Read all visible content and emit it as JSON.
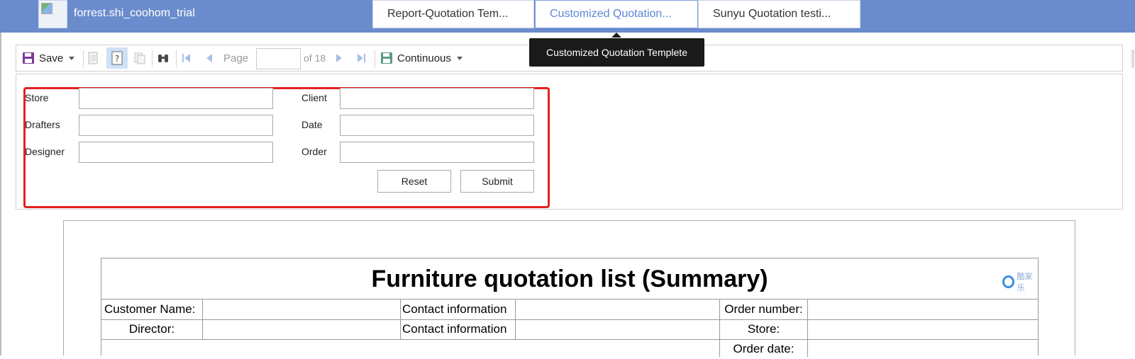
{
  "header": {
    "username": "forrest.shi_coohom_trial",
    "tabs": [
      {
        "label": "Report-Quotation Tem..."
      },
      {
        "label": "Customized Quotation..."
      },
      {
        "label": "Sunyu Quotation testi..."
      }
    ],
    "tooltip": "Customized Quotation Templete"
  },
  "toolbar": {
    "save_label": "Save",
    "page_label": "Page",
    "page_value": "",
    "of_total": "of 18",
    "view_mode": "Continuous"
  },
  "params": {
    "store_label": "Store",
    "drafters_label": "Drafters",
    "designer_label": "Designer",
    "client_label": "Client",
    "date_label": "Date",
    "order_label": "Order",
    "store_value": "",
    "drafters_value": "",
    "designer_value": "",
    "client_value": "",
    "date_value": "",
    "order_value": "",
    "reset_label": "Reset",
    "submit_label": "Submit"
  },
  "report": {
    "title": "Furniture quotation list  (Summary)",
    "logo_text": "酷家乐",
    "rows": [
      {
        "c1": "Customer Name:",
        "c2": "",
        "c3": "Contact information",
        "c4": "",
        "c5": "Order number:",
        "c6": ""
      },
      {
        "c1": "Director:",
        "c2": "",
        "c3": "Contact information",
        "c4": "",
        "c5": "Store:",
        "c6": ""
      },
      {
        "c1": "",
        "c2": "",
        "c3": "",
        "c4": "",
        "c5": "Order date:",
        "c6": ""
      }
    ]
  },
  "colors": {
    "header_bg": "#6b8ccc",
    "active_tab": "#5b86d6",
    "highlight": "#e52020"
  }
}
